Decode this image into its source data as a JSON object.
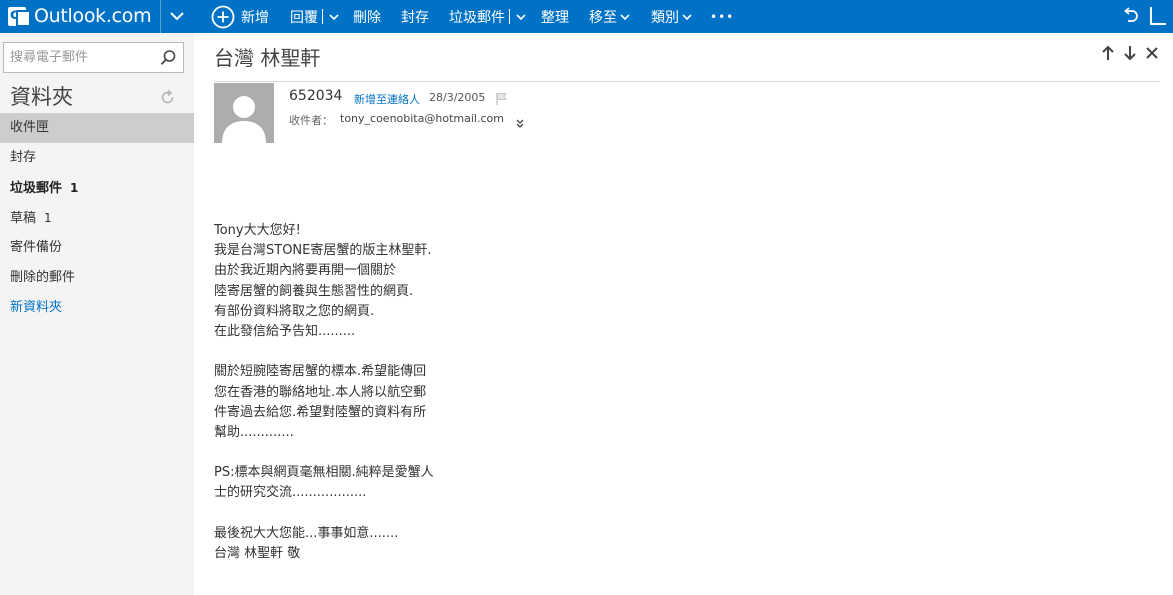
{
  "app": {
    "title": "Outlook.com",
    "accent_color": "#0072c6"
  },
  "toolbar": {
    "new_label": "新增",
    "reply_label": "回覆",
    "delete_label": "刪除",
    "archive_label": "封存",
    "junk_label": "垃圾郵件",
    "sweep_label": "整理",
    "move_label": "移至",
    "category_label": "類別",
    "more_label": "•••"
  },
  "search": {
    "placeholder": "搜尋電子郵件"
  },
  "sidebar": {
    "title": "資料夾",
    "folders": [
      {
        "label": "收件匣",
        "count": ""
      },
      {
        "label": "封存",
        "count": ""
      },
      {
        "label": "垃圾郵件",
        "count": "1"
      },
      {
        "label": "草稿",
        "count": "1"
      },
      {
        "label": "寄件備份",
        "count": ""
      },
      {
        "label": "刪除的郵件",
        "count": ""
      },
      {
        "label": "新資料夾",
        "count": ""
      }
    ]
  },
  "message": {
    "subject": "台灣 林聖軒",
    "sender": "652034",
    "add_contact": "新增至連絡人",
    "date": "28/3/2005",
    "to_label": "收件者：",
    "to_address": "tony_coenobita@hotmail.com",
    "body_lines": [
      "Tony大大您好!",
      "我是台灣STONE寄居蟹的版主林聖軒.",
      "由於我近期內將要再開一個關於",
      "陸寄居蟹的飼養與生態習性的網頁.",
      "有部份資料將取之您的網頁.",
      "在此發信給予告知.........",
      "",
      "關於短腕陸寄居蟹的標本.希望能傳回",
      "您在香港的聯絡地址.本人將以航空郵",
      "件寄過去給您.希望對陸蟹的資料有所",
      "幫助.............",
      "",
      "PS:標本與網頁毫無相關.純粹是愛蟹人",
      "士的研究交流..................",
      "",
      "最後祝大大您能...事事如意.......",
      "台灣 林聖軒 敬"
    ]
  },
  "icons": {
    "logo": "outlook-logo-icon",
    "new": "plus-circle-icon",
    "search": "search-icon",
    "refresh": "refresh-icon",
    "up": "arrow-up-icon",
    "down": "arrow-down-icon",
    "close": "close-icon",
    "flag": "flag-icon",
    "undo": "undo-icon",
    "avatar": "person-silhouette-icon"
  }
}
